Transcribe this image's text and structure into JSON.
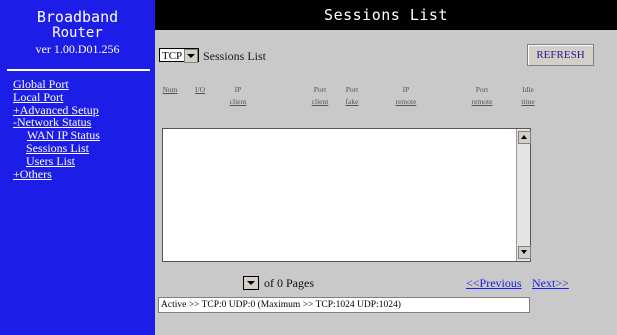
{
  "sidebar": {
    "brand_line1": "Broadband",
    "brand_line2": "Router",
    "version": "ver 1.00.D01.256",
    "items": [
      {
        "label": "Global Port"
      },
      {
        "label": "Local Port"
      },
      {
        "label": "+Advanced Setup"
      },
      {
        "label": "-Network Status"
      },
      {
        "label": "WAN IP Status"
      },
      {
        "label": "Sessions List"
      },
      {
        "label": "Users List"
      },
      {
        "label": "+Others"
      }
    ]
  },
  "header": {
    "title": "Sessions List"
  },
  "toolbar": {
    "protocol_value": "TCP",
    "label": "Sessions List",
    "refresh_label": "REFRESH"
  },
  "columns": [
    {
      "line1": "",
      "line2": "Num"
    },
    {
      "line1": "",
      "line2": "I/O"
    },
    {
      "line1": "IP",
      "line2": "client"
    },
    {
      "line1": "Port",
      "line2": "client"
    },
    {
      "line1": "Port",
      "line2": "fake"
    },
    {
      "line1": "IP",
      "line2": "remote"
    },
    {
      "line1": "Port",
      "line2": "remote"
    },
    {
      "line1": "Idle",
      "line2": "time"
    }
  ],
  "paging": {
    "of_pages": "of 0 Pages",
    "prev_label": "<<Previous",
    "next_label": "Next>>"
  },
  "status_text": "Active >> TCP:0 UDP:0 (Maximum >> TCP:1024 UDP:1024)",
  "colors": {
    "sidebar_bg": "#1d1de8",
    "header_bg": "#000000",
    "content_bg": "#c9c9c9",
    "link": "#1d1de8"
  }
}
